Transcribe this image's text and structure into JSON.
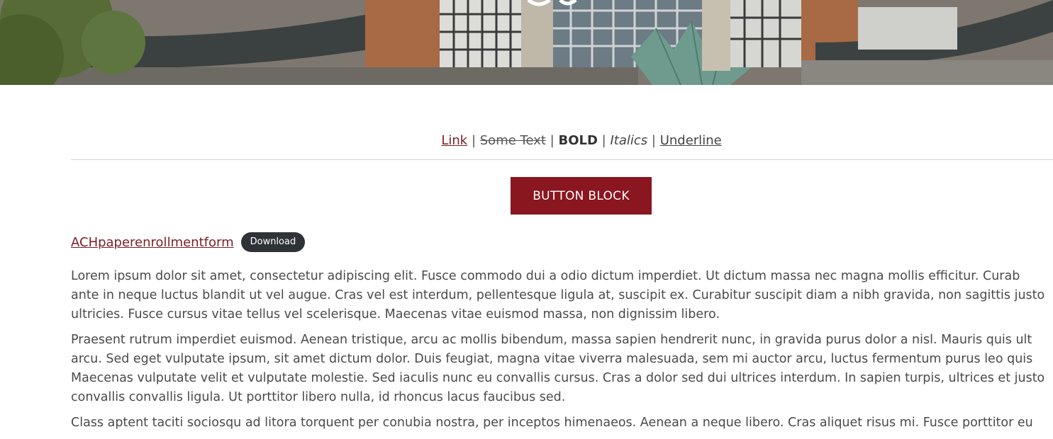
{
  "hero": {
    "image": "church-building-photo"
  },
  "text_formats": {
    "link_label": "Link",
    "separator": "|",
    "strike_label": "Some Text",
    "bold_label": "BOLD",
    "italic_label": "Italics",
    "underline_label": "Underline"
  },
  "button_block": {
    "label": "BUTTON BLOCK",
    "color": "#8a1620"
  },
  "file": {
    "name": "ACHpaperenrollmentform",
    "download_label": "Download"
  },
  "paragraphs": [
    [
      "Lorem ipsum dolor sit amet, consectetur adipiscing elit. Fusce commodo dui a odio dictum imperdiet. Ut dictum massa nec magna mollis efficitur. Curab",
      "ante in neque luctus blandit ut vel augue. Cras vel est interdum, pellentesque ligula at, suscipit ex. Curabitur suscipit diam a nibh gravida, non sagittis justo",
      "ultricies. Fusce cursus vitae tellus vel scelerisque. Maecenas vitae euismod massa, non dignissim libero."
    ],
    [
      "Praesent rutrum imperdiet euismod. Aenean tristique, arcu ac mollis bibendum, massa sapien hendrerit nunc, in gravida purus dolor a nisl. Mauris quis ult",
      "arcu. Sed eget vulputate ipsum, sit amet dictum dolor. Duis feugiat, magna vitae viverra malesuada, sem mi auctor arcu, luctus fermentum purus leo quis",
      "Maecenas vulputate velit et vulputate molestie. Sed iaculis nunc eu convallis cursus. Cras a dolor sed dui ultrices interdum. In sapien turpis, ultrices et justo",
      "convallis convallis ligula. Ut porttitor libero nulla, id rhoncus lacus faucibus sed."
    ],
    [
      "Class aptent taciti sociosqu ad litora torquent per conubia nostra, per inceptos himenaeos. Aenean a neque libero. Cras aliquet risus mi. Fusce porttitor eu"
    ]
  ],
  "colors": {
    "accent": "#8a1620",
    "link": "#7a1e24",
    "badge": "#2f3338",
    "text": "#4a4a4a"
  }
}
